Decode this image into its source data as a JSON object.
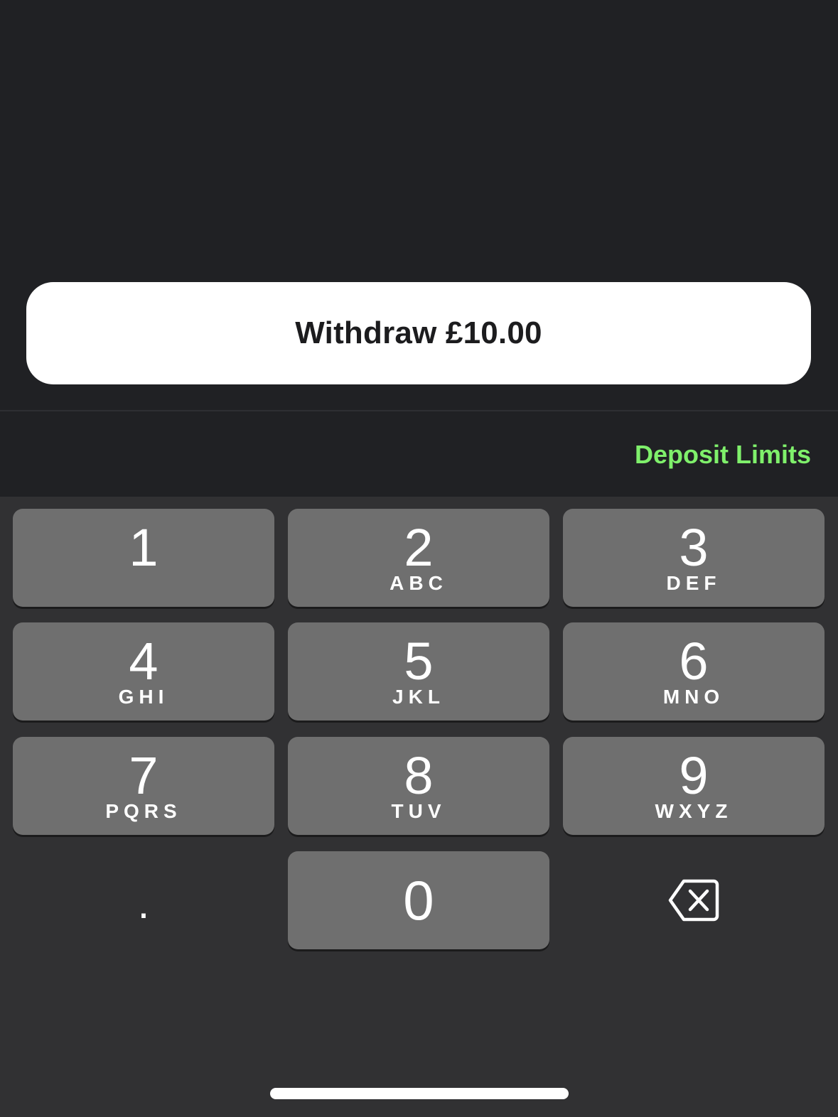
{
  "withdraw_button": {
    "label": "Withdraw £10.00"
  },
  "toolbar": {
    "deposit_limits_label": "Deposit Limits"
  },
  "keypad": {
    "keys": [
      {
        "digit": "1",
        "letters": ""
      },
      {
        "digit": "2",
        "letters": "ABC"
      },
      {
        "digit": "3",
        "letters": "DEF"
      },
      {
        "digit": "4",
        "letters": "GHI"
      },
      {
        "digit": "5",
        "letters": "JKL"
      },
      {
        "digit": "6",
        "letters": "MNO"
      },
      {
        "digit": "7",
        "letters": "PQRS"
      },
      {
        "digit": "8",
        "letters": "TUV"
      },
      {
        "digit": "9",
        "letters": "WXYZ"
      },
      {
        "digit": "0",
        "letters": ""
      }
    ],
    "decimal_label": ".",
    "backspace_icon": "backspace-icon"
  },
  "colors": {
    "background": "#202124",
    "keyboard_background": "#313133",
    "key_background": "#6f6f6f",
    "accent_green": "#7ff06b",
    "button_background": "#ffffff"
  }
}
